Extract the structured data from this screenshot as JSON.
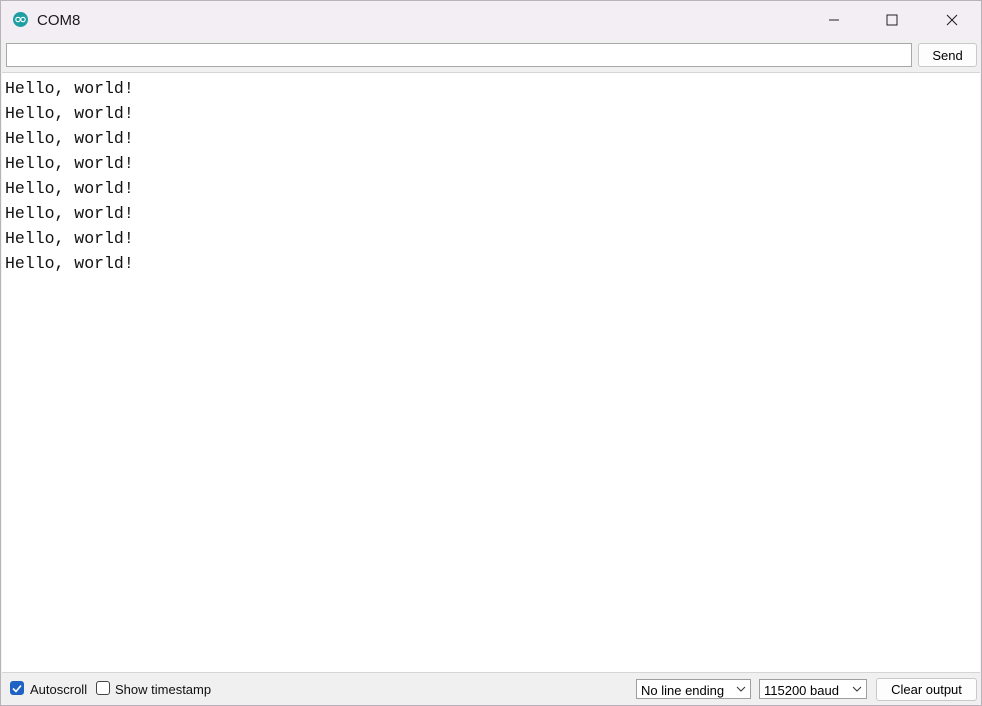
{
  "window": {
    "title": "COM8",
    "accent_color": "#1f9ea3"
  },
  "toolbar": {
    "input_value": "",
    "send_label": "Send"
  },
  "output": {
    "lines": [
      "Hello, world!",
      "Hello, world!",
      "Hello, world!",
      "Hello, world!",
      "Hello, world!",
      "Hello, world!",
      "Hello, world!",
      "Hello, world!"
    ]
  },
  "statusbar": {
    "autoscroll": {
      "label": "Autoscroll",
      "checked": true
    },
    "timestamp": {
      "label": "Show timestamp",
      "checked": false
    },
    "line_ending": {
      "selected": "No line ending"
    },
    "baud_rate": {
      "selected": "115200 baud"
    },
    "clear_label": "Clear output",
    "check_color": "#1e63c4"
  }
}
